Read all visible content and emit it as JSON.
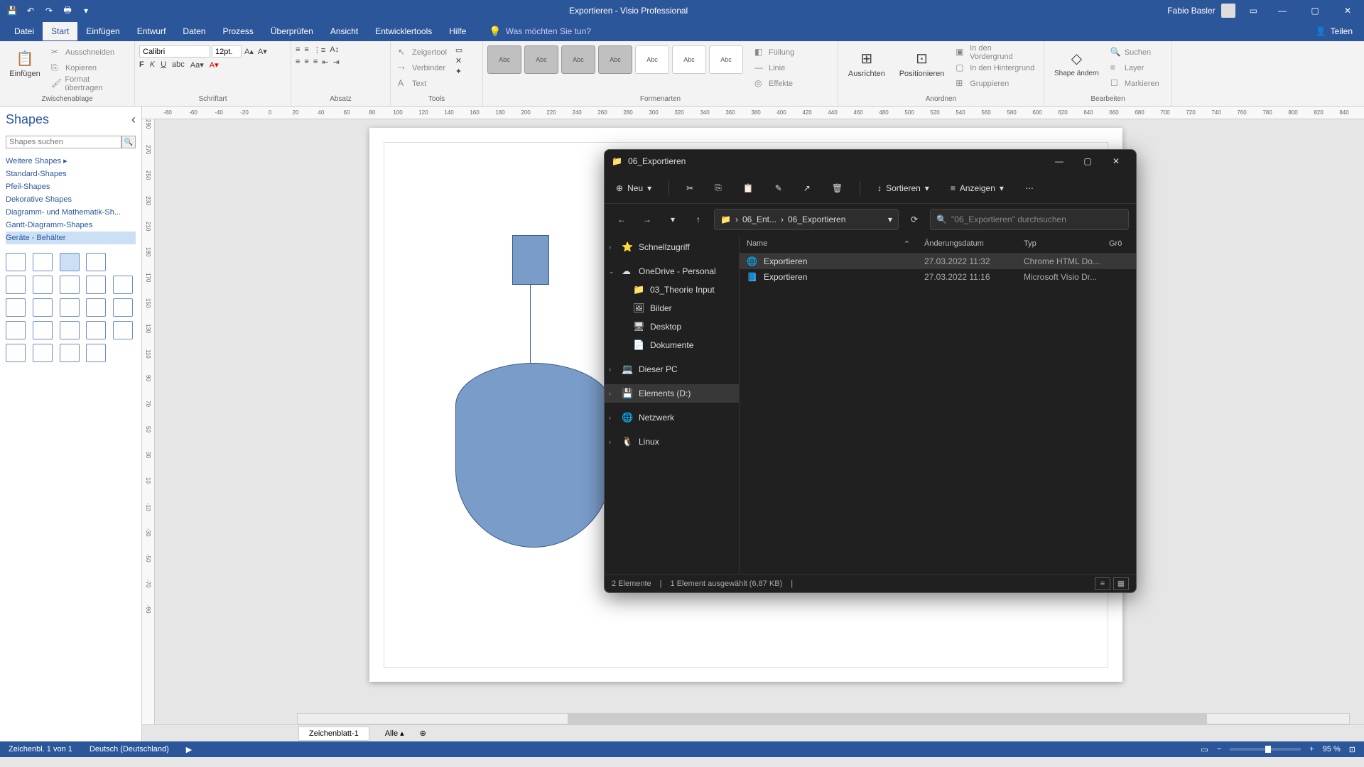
{
  "titlebar": {
    "title": "Exportieren  -  Visio Professional",
    "user": "Fabio Basler",
    "share": "Teilen"
  },
  "tabs": {
    "datei": "Datei",
    "start": "Start",
    "einfuegen": "Einfügen",
    "entwurf": "Entwurf",
    "daten": "Daten",
    "prozess": "Prozess",
    "ueberpruefen": "Überprüfen",
    "ansicht": "Ansicht",
    "entwicklertools": "Entwicklertools",
    "hilfe": "Hilfe",
    "tellme": "Was möchten Sie tun?"
  },
  "ribbon": {
    "zwischenablage": {
      "label": "Zwischenablage",
      "einfuegen": "Einfügen",
      "ausschneiden": "Ausschneiden",
      "kopieren": "Kopieren",
      "format": "Format übertragen"
    },
    "schriftart": {
      "label": "Schriftart",
      "font": "Calibri",
      "size": "12pt."
    },
    "absatz": {
      "label": "Absatz"
    },
    "tools": {
      "label": "Tools",
      "zeiger": "Zeigertool",
      "verbinder": "Verbinder",
      "text": "Text"
    },
    "formenarten": {
      "label": "Formenarten",
      "abc": "Abc"
    },
    "anordnen": {
      "label": "Anordnen",
      "ausrichten": "Ausrichten",
      "positionieren": "Positionieren",
      "vordergrund": "In den Vordergrund",
      "hintergrund": "In den Hintergrund",
      "gruppieren": "Gruppieren"
    },
    "shapeformat": {
      "label": "Shape ändern",
      "fuellung": "Füllung",
      "linie": "Linie",
      "effekte": "Effekte"
    },
    "bearbeiten": {
      "label": "Bearbeiten",
      "shape": "Shape ändern",
      "suchen": "Suchen",
      "layer": "Layer",
      "markieren": "Markieren"
    }
  },
  "shapes": {
    "title": "Shapes",
    "search": "Shapes suchen",
    "more": "Weitere Shapes",
    "cats": [
      "Standard-Shapes",
      "Pfeil-Shapes",
      "Dekorative Shapes",
      "Diagramm- und Mathematik-Sh...",
      "Gantt-Diagramm-Shapes",
      "Geräte - Behälter"
    ]
  },
  "pages": {
    "tab1": "Zeichenblatt-1",
    "all": "Alle"
  },
  "status": {
    "page": "Zeichenbl. 1 von 1",
    "lang": "Deutsch (Deutschland)",
    "zoom": "95 %"
  },
  "explorer": {
    "title": "06_Exportieren",
    "neu": "Neu",
    "sortieren": "Sortieren",
    "anzeigen": "Anzeigen",
    "path1": "06_Ent...",
    "path2": "06_Exportieren",
    "search": "\"06_Exportieren\" durchsuchen",
    "sidebar": {
      "schnell": "Schnellzugriff",
      "onedrive": "OneDrive - Personal",
      "theorie": "03_Theorie Input",
      "bilder": "Bilder",
      "desktop": "Desktop",
      "dokumente": "Dokumente",
      "pc": "Dieser PC",
      "elements": "Elements (D:)",
      "netzwerk": "Netzwerk",
      "linux": "Linux"
    },
    "cols": {
      "name": "Name",
      "date": "Änderungsdatum",
      "type": "Typ",
      "size": "Grö"
    },
    "files": [
      {
        "name": "Exportieren",
        "date": "27.03.2022 11:32",
        "type": "Chrome HTML Do..."
      },
      {
        "name": "Exportieren",
        "date": "27.03.2022 11:16",
        "type": "Microsoft Visio Dr..."
      }
    ],
    "status": {
      "count": "2 Elemente",
      "selected": "1 Element ausgewählt (6,87 KB)"
    }
  }
}
